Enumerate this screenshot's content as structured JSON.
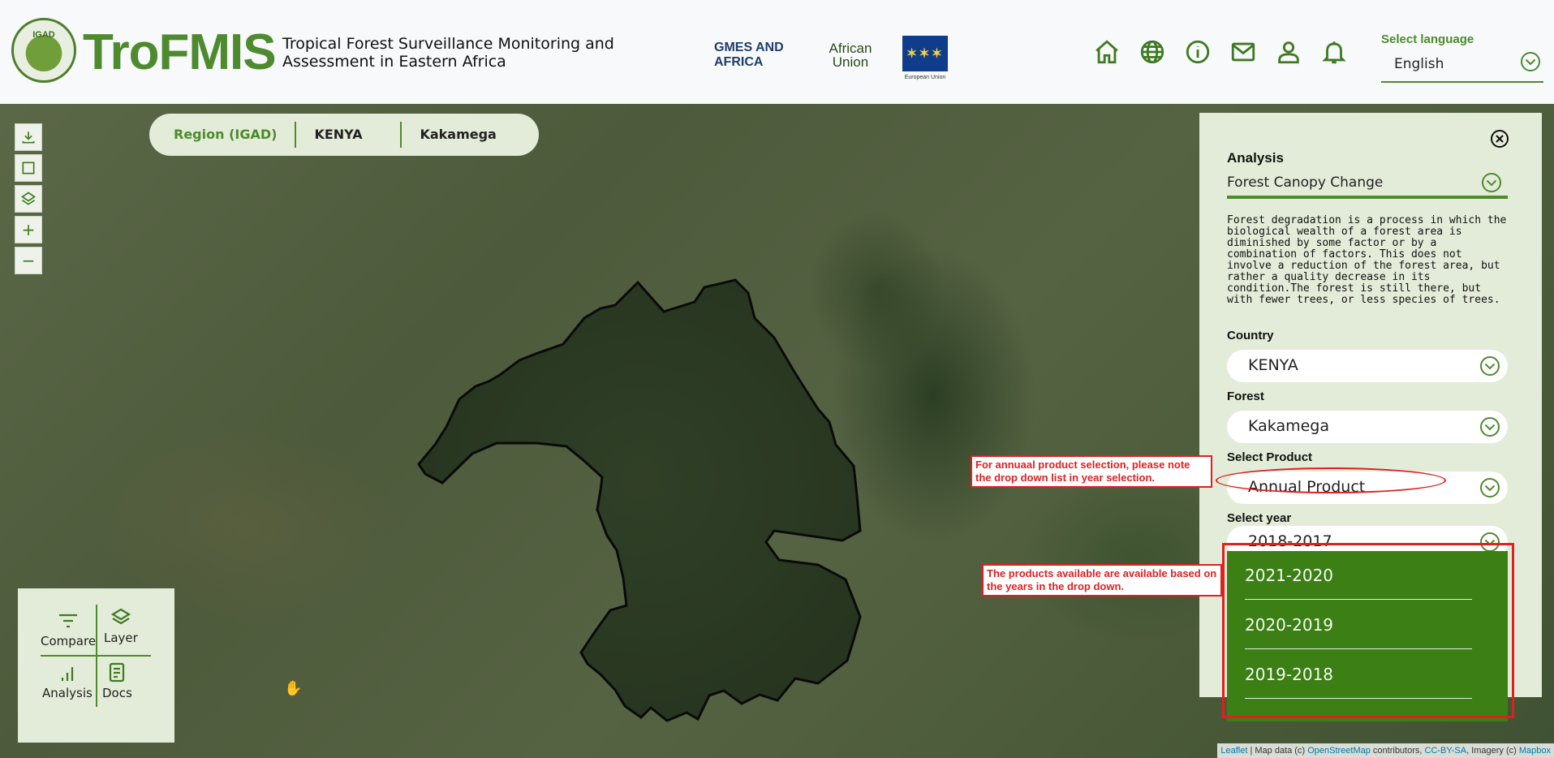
{
  "header": {
    "logo_seal_text": "IGAD",
    "brand": "TroFMIS",
    "tagline": "Tropical Forest Surveillance Monitoring and Assessment in Eastern Africa",
    "partners": {
      "gmes": "GMES AND AFRICA",
      "au": "African Union",
      "eu": "European Union"
    },
    "icons": [
      "home-icon",
      "globe-icon",
      "info-icon",
      "mail-icon",
      "user-icon",
      "bell-icon"
    ],
    "language_label": "Select language",
    "language_value": "English"
  },
  "map": {
    "tools": [
      "download-icon",
      "draw-rectangle-icon",
      "layers-icon",
      "zoom-in-icon",
      "zoom-out-icon"
    ],
    "zoom_in_label": "+",
    "zoom_out_label": "−",
    "breadcrumb": {
      "region": "Region (IGAD)",
      "country": "KENYA",
      "forest": "Kakamega"
    },
    "dock": {
      "compare": "Compare",
      "layer": "Layer",
      "analysis": "Analysis",
      "docs": "Docs"
    },
    "attribution": {
      "leaflet": "Leaflet",
      "text1": " | Map data (c) ",
      "osm": "OpenStreetMap",
      "text2": " contributors, ",
      "license": "CC-BY-SA",
      "text3": ", Imagery (c) ",
      "mapbox": "Mapbox"
    }
  },
  "panel": {
    "analysis_label": "Analysis",
    "analysis_value": "Forest Canopy Change",
    "description": "Forest degradation is a process in which the biological wealth of a forest area is diminished by some factor or by a combination of factors. This does not involve a reduction of the forest area, but rather a quality decrease in its condition.The forest is still there, but with fewer trees, or less species of trees.",
    "country_label": "Country",
    "country_value": "KENYA",
    "forest_label": "Forest",
    "forest_value": "Kakamega",
    "product_label": "Select Product",
    "product_value": "Annual Product",
    "year_label": "Select year",
    "year_value": "2018-2017",
    "year_options": [
      "2021-2020",
      "2020-2019",
      "2019-2018"
    ]
  },
  "annotations": {
    "product_note": "For annuaal product selection, please note the drop down list in year selection.",
    "years_note": "The products available are available based on the years in the drop down."
  },
  "colors": {
    "brand_green": "#4e8a2e",
    "menu_green": "#3b7f15",
    "panel_bg": "#e3ecd8",
    "annotation_red": "#e02020"
  }
}
